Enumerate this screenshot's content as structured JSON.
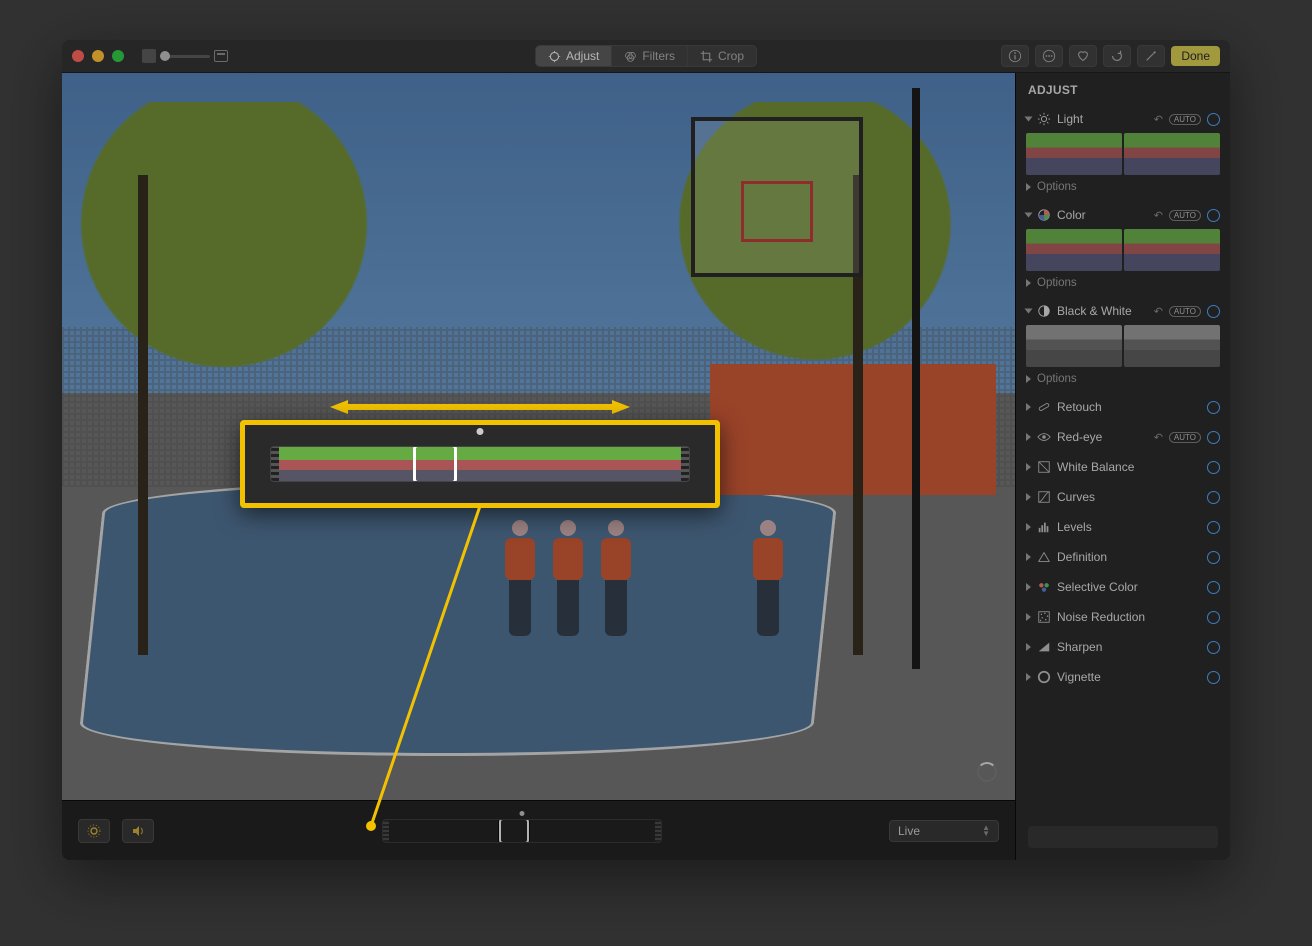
{
  "toolbar": {
    "segments": {
      "adjust": "Adjust",
      "filters": "Filters",
      "crop": "Crop"
    },
    "done": "Done"
  },
  "strip": {
    "mode": "Live"
  },
  "panel": {
    "header": "ADJUST",
    "sections": {
      "light": {
        "title": "Light",
        "auto": "AUTO",
        "options": "Options"
      },
      "color": {
        "title": "Color",
        "auto": "AUTO",
        "options": "Options"
      },
      "bw": {
        "title": "Black & White",
        "auto": "AUTO",
        "options": "Options"
      },
      "retouch": {
        "title": "Retouch"
      },
      "redeye": {
        "title": "Red-eye",
        "auto": "AUTO"
      },
      "wb": {
        "title": "White Balance"
      },
      "curves": {
        "title": "Curves"
      },
      "levels": {
        "title": "Levels"
      },
      "definition": {
        "title": "Definition"
      },
      "selcolor": {
        "title": "Selective Color"
      },
      "noise": {
        "title": "Noise Reduction"
      },
      "sharpen": {
        "title": "Sharpen"
      },
      "vignette": {
        "title": "Vignette"
      }
    }
  }
}
